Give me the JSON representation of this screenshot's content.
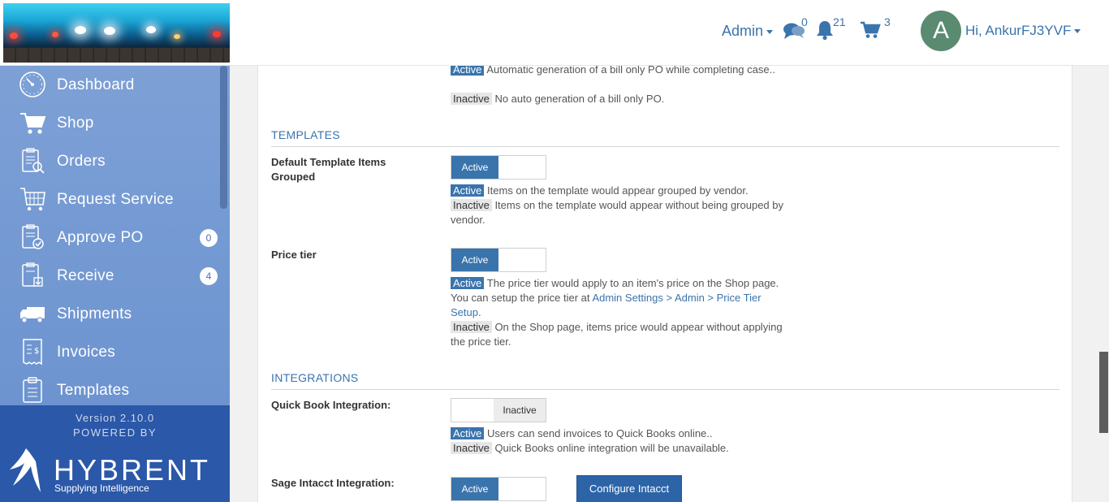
{
  "header": {
    "admin_label": "Admin",
    "messages_count": "0",
    "notifications_count": "21",
    "cart_count": "3",
    "avatar_letter": "A",
    "greeting": "Hi, AnkurFJ3YVF"
  },
  "sidebar": {
    "items": [
      {
        "label": "Dashboard",
        "icon": "dashboard-icon"
      },
      {
        "label": "Shop",
        "icon": "cart-icon"
      },
      {
        "label": "Orders",
        "icon": "orders-icon"
      },
      {
        "label": "Request Service",
        "icon": "request-service-icon"
      },
      {
        "label": "Approve PO",
        "icon": "approve-po-icon",
        "badge": "0"
      },
      {
        "label": "Receive",
        "icon": "receive-icon",
        "badge": "4"
      },
      {
        "label": "Shipments",
        "icon": "truck-icon"
      },
      {
        "label": "Invoices",
        "icon": "invoice-icon"
      },
      {
        "label": "Templates",
        "icon": "clipboard-icon"
      }
    ],
    "version": "Version 2.10.0",
    "powered_by": "POWERED BY",
    "brand": "HYBRENT",
    "tagline": "Supplying Intelligence"
  },
  "content": {
    "top_partial": {
      "active_tag": "Active",
      "active_desc": "Automatic generation of a bill only PO while completing case..",
      "inactive_tag": "Inactive",
      "inactive_desc": "No auto generation of a bill only PO."
    },
    "templates_section": {
      "heading": "TEMPLATES",
      "default_grouped": {
        "label": "Default Template Items Grouped",
        "toggle": "Active",
        "active_tag": "Active",
        "active_desc": "Items on the template would appear grouped by vendor.",
        "inactive_tag": "Inactive",
        "inactive_desc": "Items on the template would appear without being grouped by vendor."
      },
      "price_tier": {
        "label": "Price tier",
        "toggle": "Active",
        "active_tag": "Active",
        "active_desc": "The price tier would apply to an item's price on the Shop page. You can setup the price tier at",
        "link": "Admin Settings > Admin > Price Tier Setup",
        "inactive_tag": "Inactive",
        "inactive_desc": "On the Shop page, items price would appear without applying the price tier."
      }
    },
    "integrations_section": {
      "heading": "INTEGRATIONS",
      "quickbook": {
        "label": "Quick Book Integration:",
        "toggle": "Inactive",
        "active_tag": "Active",
        "active_desc": "Users can send invoices to Quick Books online..",
        "inactive_tag": "Inactive",
        "inactive_desc": "Quick Books online integration will be unavailable."
      },
      "sage": {
        "label": "Sage Intacct Integration:",
        "toggle": "Active",
        "button": "Configure Intacct"
      }
    }
  },
  "colors": {
    "accent": "#3a74ad",
    "sidebar": "#7da0d6",
    "sidebar_footer": "#2b58a8",
    "avatar": "#5a8a70"
  }
}
